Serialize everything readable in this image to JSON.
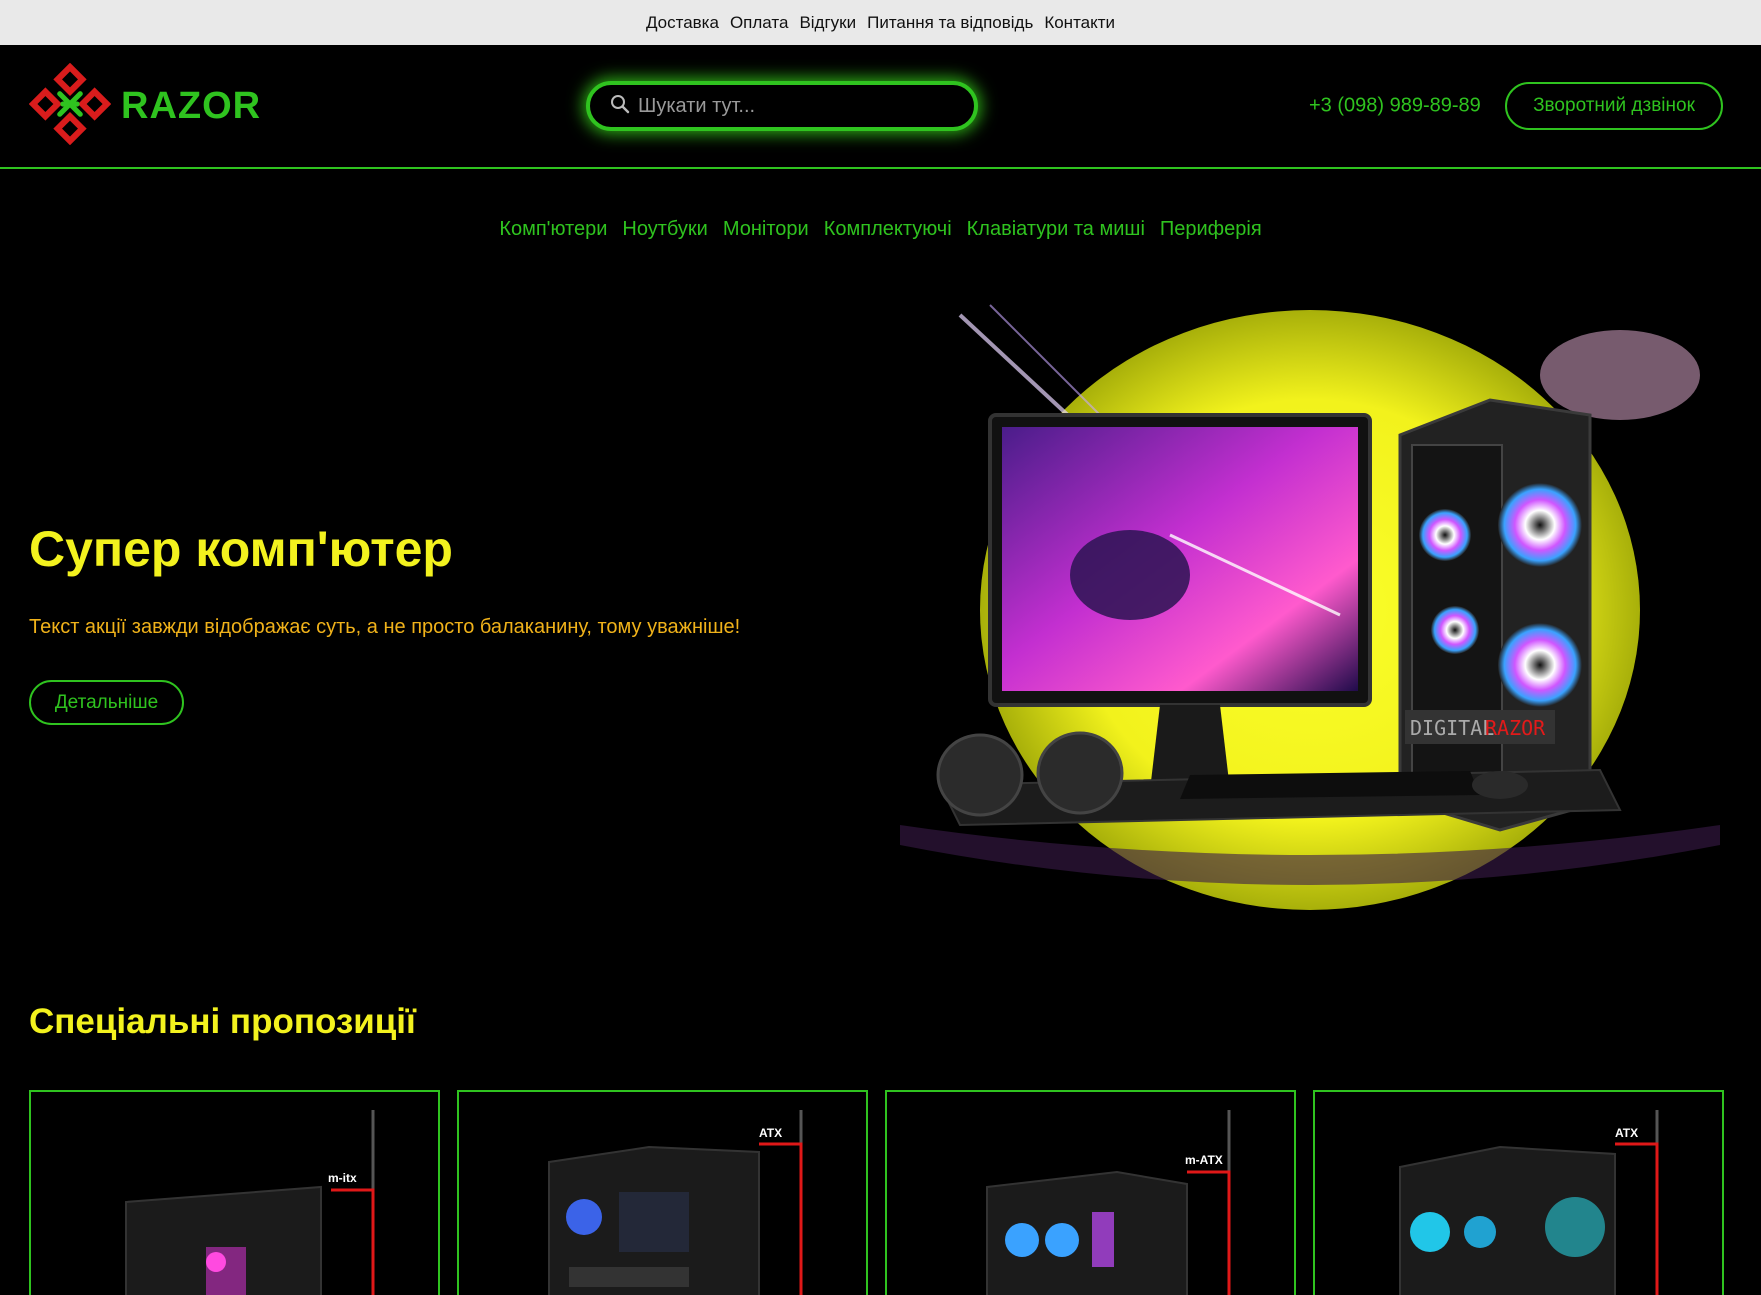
{
  "topbar": {
    "links": [
      "Доставка",
      "Оплата",
      "Відгуки",
      "Питання та відповідь",
      "Контакти"
    ]
  },
  "header": {
    "logo_text": "RAZOR",
    "search_placeholder": "Шукати тут...",
    "phone": "+3 (098) 989-89-89",
    "callback_label": "Зворотний дзвінок"
  },
  "nav": {
    "items": [
      "Комп'ютери",
      "Ноутбуки",
      "Монітори",
      "Комплектуючі",
      "Клавіатури та миші",
      "Периферія"
    ]
  },
  "hero": {
    "title": "Супер комп'ютер",
    "text": "Текст акції завжди відображає суть, а не просто балаканину, тому уважніше!",
    "button_label": "Детальніше",
    "image_labels": {
      "brand_left": "DIGITAL",
      "brand_right": "RAZOR"
    }
  },
  "offers": {
    "title": "Спеціальні пропозиції",
    "cards": [
      {
        "form_factor": "m-itx"
      },
      {
        "form_factor": "ATX"
      },
      {
        "form_factor": "m-ATX"
      },
      {
        "form_factor": "ATX"
      }
    ]
  },
  "colors": {
    "accent_green": "#2fc31f",
    "title_yellow": "#f3f21e",
    "text_orange": "#f0b21a",
    "logo_red": "#d91c1c",
    "background": "#000000"
  },
  "icons": {
    "logo": "razor-logo-icon",
    "search": "search-icon"
  }
}
